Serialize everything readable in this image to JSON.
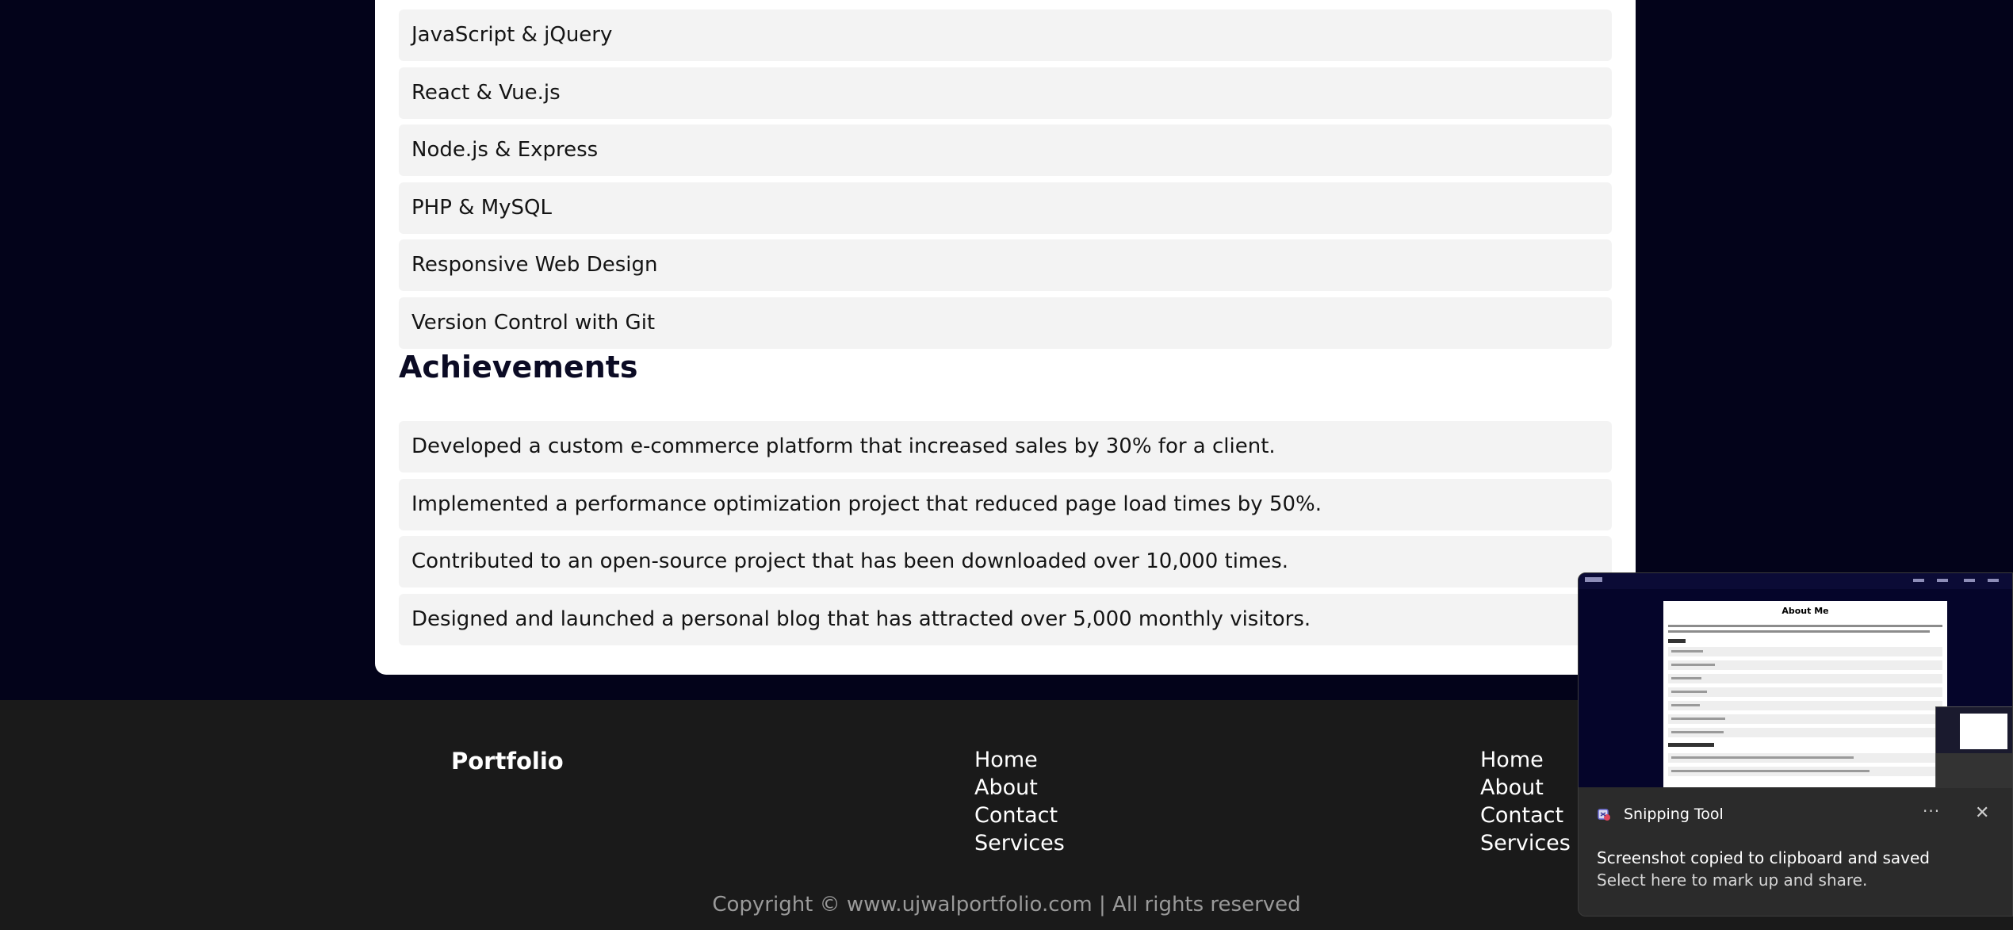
{
  "skills": {
    "items": [
      "JavaScript & jQuery",
      "React & Vue.js",
      "Node.js & Express",
      "PHP & MySQL",
      "Responsive Web Design",
      "Version Control with Git"
    ]
  },
  "achievements": {
    "heading": "Achievements",
    "items": [
      "Developed a custom e-commerce platform that increased sales by 30% for a client.",
      "Implemented a performance optimization project that reduced page load times by 50%.",
      "Contributed to an open-source project that has been downloaded over 10,000 times.",
      "Designed and launched a personal blog that has attracted over 5,000 monthly visitors."
    ]
  },
  "footer": {
    "brand": "Portfolio",
    "links_col1": [
      "Home",
      "About",
      "Contact",
      "Services"
    ],
    "links_col2": [
      "Home",
      "About",
      "Contact",
      "Services"
    ],
    "copyright": "Copyright © www.ujwalportfolio.com | All rights reserved"
  },
  "snipping_toast": {
    "app_name": "Snipping Tool",
    "more_icon": "more-horizontal-icon",
    "close_icon": "close-icon",
    "message": "Screenshot copied to clipboard and saved",
    "submessage": "Select here to mark up and share.",
    "thumbnail": {
      "title": "About Me"
    }
  },
  "colors": {
    "background": "#03031a",
    "card": "#ffffff",
    "item_bg": "#f3f3f3",
    "footer_bg": "#1a1a1a",
    "toast_bg": "#2b2b2b"
  }
}
